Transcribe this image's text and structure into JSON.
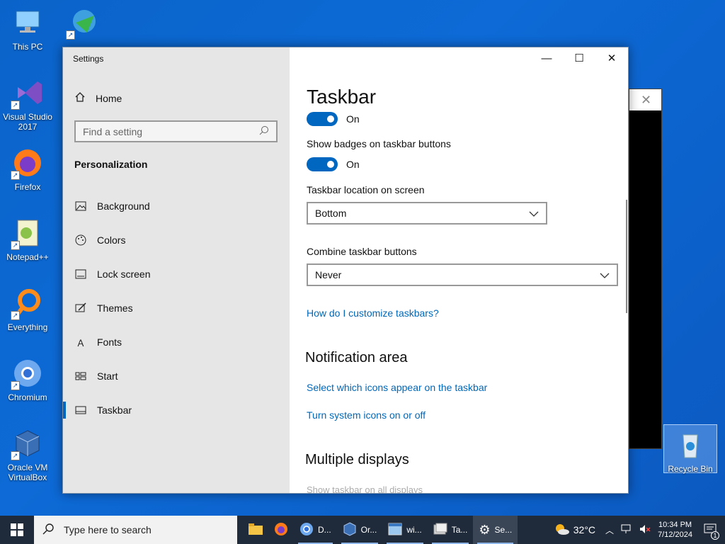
{
  "desktop": {
    "icons": [
      {
        "label": "This PC"
      },
      {
        "label": "Visual Studio 2017"
      },
      {
        "label": "Firefox"
      },
      {
        "label": "Notepad++"
      },
      {
        "label": "Everything"
      },
      {
        "label": "Chromium"
      },
      {
        "label": "Oracle VM VirtualBox"
      },
      {
        "label": "Recycle Bin"
      }
    ]
  },
  "settings": {
    "window_title": "Settings",
    "sidebar": {
      "home": "Home",
      "search_placeholder": "Find a setting",
      "section": "Personalization",
      "items": [
        {
          "label": "Background",
          "icon": "picture-icon"
        },
        {
          "label": "Colors",
          "icon": "palette-icon"
        },
        {
          "label": "Lock screen",
          "icon": "lock-screen-icon"
        },
        {
          "label": "Themes",
          "icon": "brush-icon"
        },
        {
          "label": "Fonts",
          "icon": "font-icon"
        },
        {
          "label": "Start",
          "icon": "start-grid-icon"
        },
        {
          "label": "Taskbar",
          "icon": "taskbar-icon",
          "active": true
        }
      ]
    },
    "content": {
      "title": "Taskbar",
      "toggle1_state": "On",
      "badges_label": "Show badges on taskbar buttons",
      "badges_state": "On",
      "location_label": "Taskbar location on screen",
      "location_value": "Bottom",
      "combine_label": "Combine taskbar buttons",
      "combine_value": "Never",
      "customize_link": "How do I customize taskbars?",
      "notification_heading": "Notification area",
      "select_icons_link": "Select which icons appear on the taskbar",
      "system_icons_link": "Turn system icons on or off",
      "multiple_heading": "Multiple displays",
      "show_all_displays": "Show taskbar on all displays"
    }
  },
  "taskbar": {
    "search_placeholder": "Type here to search",
    "apps": [
      {
        "label": "",
        "icon": "file-explorer-icon"
      },
      {
        "label": "",
        "icon": "firefox-icon"
      },
      {
        "label": "D...",
        "icon": "chromium-icon"
      },
      {
        "label": "Or...",
        "icon": "virtualbox-icon"
      },
      {
        "label": "wi...",
        "icon": "window-app-icon"
      },
      {
        "label": "Ta...",
        "icon": "task-app-icon"
      },
      {
        "label": "Se...",
        "icon": "settings-gear-icon"
      }
    ],
    "weather": "32°C",
    "time": "10:34 PM",
    "date": "7/12/2024",
    "notification_count": "1"
  },
  "colors": {
    "accent": "#0067c0",
    "link": "#0067b8",
    "desktop": "#0a63c9",
    "taskbar": "#1f2a3a"
  }
}
